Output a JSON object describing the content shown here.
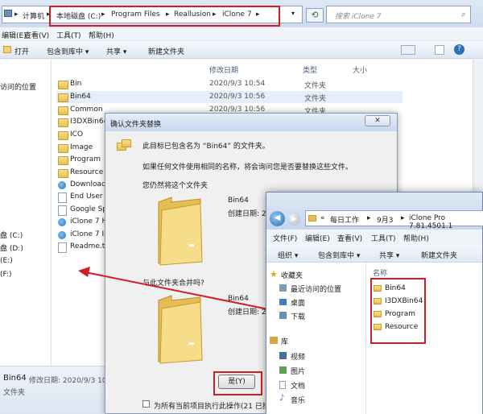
{
  "main": {
    "breadcrumb": [
      "计算机",
      "本地磁盘 (C:)",
      "Program Files",
      "Reallusion",
      "iClone 7"
    ],
    "search_placeholder": "搜索 iClone 7",
    "menu": [
      "编辑(E)",
      "查看(V)",
      "工具(T)",
      "帮助(H)"
    ],
    "toolbar": [
      "打开",
      "包含到库中 ▾",
      "共享 ▾",
      "新建文件夹"
    ],
    "columns": {
      "date": "修改日期",
      "type": "类型",
      "size": "大小"
    },
    "nav": [
      "访问的位置",
      "盘 (C:)",
      "盘 (D:)",
      "(E:)",
      "(F:)"
    ],
    "files": [
      {
        "name": "Bin",
        "date": "2020/9/3 10:54",
        "type": "文件夹",
        "icon": "folder"
      },
      {
        "name": "Bin64",
        "date": "2020/9/3 10:56",
        "type": "文件夹",
        "icon": "folder"
      },
      {
        "name": "Common",
        "date": "2020/9/3 10:56",
        "type": "文件夹",
        "icon": "folder"
      },
      {
        "name": "I3DXBin64",
        "date": "",
        "type": "",
        "icon": "folder"
      },
      {
        "name": "ICO",
        "date": "",
        "type": "",
        "icon": "folder"
      },
      {
        "name": "Image",
        "date": "",
        "type": "",
        "icon": "folder"
      },
      {
        "name": "Program",
        "date": "",
        "type": "",
        "icon": "folder"
      },
      {
        "name": "Resource",
        "date": "",
        "type": "",
        "icon": "folder"
      },
      {
        "name": "Download",
        "date": "",
        "type": "",
        "icon": "app"
      },
      {
        "name": "End User",
        "date": "",
        "type": "",
        "icon": "file"
      },
      {
        "name": "Google Sp",
        "date": "",
        "type": "",
        "icon": "file"
      },
      {
        "name": "iClone 7 H",
        "date": "",
        "type": "",
        "icon": "app"
      },
      {
        "name": "iClone 7 In",
        "date": "",
        "type": "",
        "icon": "app"
      },
      {
        "name": "Readme.tx",
        "date": "",
        "type": "",
        "icon": "file"
      }
    ],
    "status": {
      "name": "Bin64",
      "detail": "修改日期: 2020/9/3 10:",
      "type": "文件夹"
    }
  },
  "dialog": {
    "title": "确认文件夹替换",
    "message": "此目标已包含名为 “Bin64” 的文件夹。",
    "detail": "如果任何文件使用相同的名称，将会询问您是否要替换这些文件。",
    "question": "您仍然将这个文件夹",
    "target": {
      "name": "Bin64",
      "created": "创建日期: 20"
    },
    "merge_label": "与此文件夹合并吗?",
    "source": {
      "name": "Bin64",
      "created": "创建日期: 2"
    },
    "yes_button": "是(Y)",
    "checkbox_label": "为所有当前项目执行此操作(21 已找到"
  },
  "win2": {
    "breadcrumb": [
      "«",
      "每日工作",
      "9月3",
      "iClone Pro 7.81.4501.1"
    ],
    "menu": [
      "文件(F)",
      "编辑(E)",
      "查看(V)",
      "工具(T)",
      "帮助(H)"
    ],
    "toolbar": [
      "组织 ▾",
      "包含到库中 ▾",
      "共享 ▾",
      "新建文件夹"
    ],
    "column_name": "名称",
    "nav": [
      {
        "label": "收藏夹",
        "icon": "star"
      },
      {
        "label": "最近访问的位置",
        "icon": "recent"
      },
      {
        "label": "桌面",
        "icon": "desktop"
      },
      {
        "label": "下载",
        "icon": "download"
      },
      {
        "label": "库",
        "icon": "library"
      },
      {
        "label": "视频",
        "icon": "video"
      },
      {
        "label": "图片",
        "icon": "picture"
      },
      {
        "label": "文档",
        "icon": "document"
      },
      {
        "label": "音乐",
        "icon": "music"
      }
    ],
    "files": [
      "Bin64",
      "I3DXBin64",
      "Program",
      "Resource"
    ]
  },
  "colors": {
    "highlight": "#d21d24",
    "accent": "#2a6fb8"
  }
}
